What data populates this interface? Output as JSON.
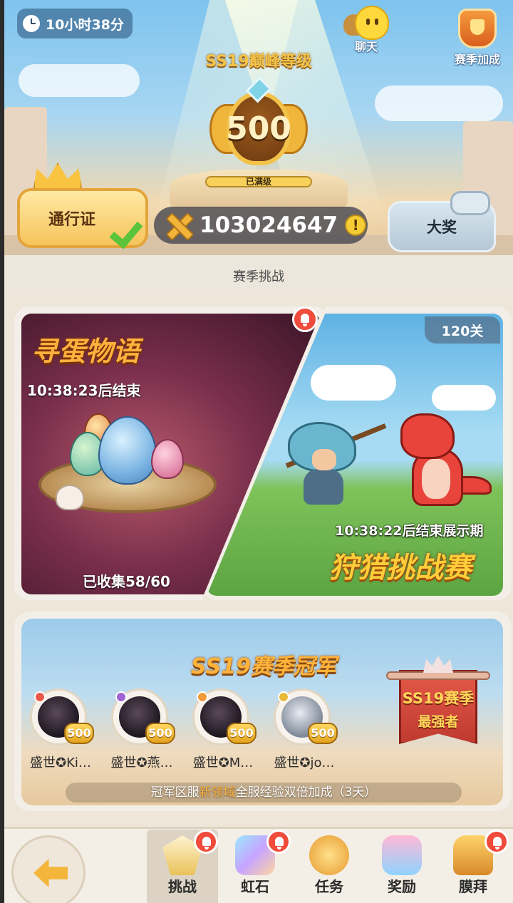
{
  "header": {
    "countdown": "10小时38分",
    "chat_label": "聊天",
    "season_bonus_label": "赛季加成",
    "peak_title": "SS19巅峰等级",
    "level": "500",
    "max_label": "已满级",
    "pass_label": "通行证",
    "currency_amount": "103024647",
    "currency_info": "!",
    "grand_prize_label": "大奖"
  },
  "section_title": "赛季挑战",
  "egg_event": {
    "title": "寻蛋物语",
    "timer": "10:38:23后结束",
    "collected": "已收集58/60"
  },
  "hunt_event": {
    "levels": "120关",
    "timer": "10:38:22后结束展示期",
    "title": "狩猎挑战赛"
  },
  "champions": {
    "title": "SS19赛季冠军",
    "strongest_line1": "SS19赛季",
    "strongest_line2": "最强者",
    "players": [
      {
        "name": "盛世✪Ki…",
        "level": "500"
      },
      {
        "name": "盛世✪燕…",
        "level": "500"
      },
      {
        "name": "盛世✪M…",
        "level": "500"
      },
      {
        "name": "盛世✪jo…",
        "level": "500"
      }
    ],
    "bonus_prefix": "冠军区服",
    "bonus_highlight": "新领域",
    "bonus_suffix": "全服经验双倍加成（3天）"
  },
  "nav": {
    "tabs": [
      {
        "label": "挑战"
      },
      {
        "label": "虹石"
      },
      {
        "label": "任务"
      },
      {
        "label": "奖励"
      },
      {
        "label": "膜拜"
      }
    ]
  },
  "colors": {
    "accent_gold": "#ffb13d",
    "notification_red": "#f04b3b",
    "check_green": "#5bc43b"
  }
}
